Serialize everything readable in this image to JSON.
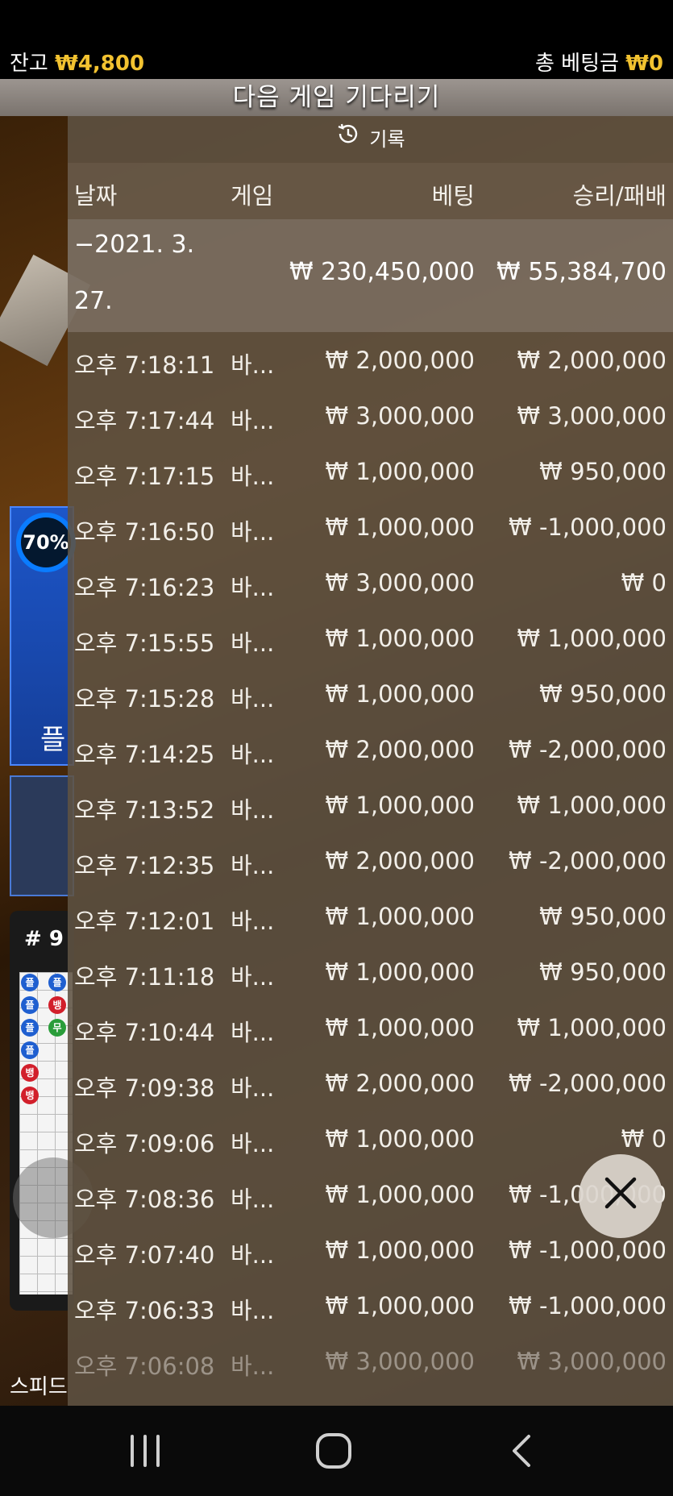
{
  "balance": {
    "label": "잔고",
    "amount": "₩4,800"
  },
  "total_bet": {
    "label": "총 베팅금",
    "amount": "₩0"
  },
  "status": "다음 게임 기다리기",
  "history": {
    "title": "기록",
    "columns": {
      "date": "날짜",
      "game": "게임",
      "bet": "베팅",
      "result": "승리/패배"
    },
    "summary": {
      "date_line1": "−2021. 3.",
      "date_line2": "27.",
      "bet": "₩ 230,450,000",
      "result": "₩ 55,384,700"
    },
    "rows": [
      {
        "time": "오후 7:18:11",
        "game": "바...",
        "bet": "₩ 2,000,000",
        "result": "₩ 2,000,000"
      },
      {
        "time": "오후 7:17:44",
        "game": "바...",
        "bet": "₩ 3,000,000",
        "result": "₩ 3,000,000"
      },
      {
        "time": "오후 7:17:15",
        "game": "바...",
        "bet": "₩ 1,000,000",
        "result": "₩ 950,000"
      },
      {
        "time": "오후 7:16:50",
        "game": "바...",
        "bet": "₩ 1,000,000",
        "result": "₩ -1,000,000"
      },
      {
        "time": "오후 7:16:23",
        "game": "바...",
        "bet": "₩ 3,000,000",
        "result": "₩ 0"
      },
      {
        "time": "오후 7:15:55",
        "game": "바...",
        "bet": "₩ 1,000,000",
        "result": "₩ 1,000,000"
      },
      {
        "time": "오후 7:15:28",
        "game": "바...",
        "bet": "₩ 1,000,000",
        "result": "₩ 950,000"
      },
      {
        "time": "오후 7:14:25",
        "game": "바...",
        "bet": "₩ 2,000,000",
        "result": "₩ -2,000,000"
      },
      {
        "time": "오후 7:13:52",
        "game": "바...",
        "bet": "₩ 1,000,000",
        "result": "₩ 1,000,000"
      },
      {
        "time": "오후 7:12:35",
        "game": "바...",
        "bet": "₩ 2,000,000",
        "result": "₩ -2,000,000"
      },
      {
        "time": "오후 7:12:01",
        "game": "바...",
        "bet": "₩ 1,000,000",
        "result": "₩ 950,000"
      },
      {
        "time": "오후 7:11:18",
        "game": "바...",
        "bet": "₩ 1,000,000",
        "result": "₩ 950,000"
      },
      {
        "time": "오후 7:10:44",
        "game": "바...",
        "bet": "₩ 1,000,000",
        "result": "₩ 1,000,000"
      },
      {
        "time": "오후 7:09:38",
        "game": "바...",
        "bet": "₩ 2,000,000",
        "result": "₩ -2,000,000"
      },
      {
        "time": "오후 7:09:06",
        "game": "바...",
        "bet": "₩ 1,000,000",
        "result": "₩ 0"
      },
      {
        "time": "오후 7:08:36",
        "game": "바...",
        "bet": "₩ 1,000,000",
        "result": "₩ -1,000,000"
      },
      {
        "time": "오후 7:07:40",
        "game": "바...",
        "bet": "₩ 1,000,000",
        "result": "₩ -1,000,000"
      },
      {
        "time": "오후 7:06:33",
        "game": "바...",
        "bet": "₩ 1,000,000",
        "result": "₩ -1,000,000"
      },
      {
        "time": "오후 7:06:08",
        "game": "바...",
        "bet": "₩ 3,000,000",
        "result": "₩ 3,000,000"
      }
    ]
  },
  "background_game": {
    "timer_percent": "70%",
    "panel_char": "플",
    "road_title": "# 9",
    "bottom_label": "스피드",
    "road_marks": [
      "플",
      "플",
      "플",
      "뱅",
      "플",
      "무",
      "플",
      "뱅",
      "뱅"
    ]
  },
  "colors": {
    "accent_gold": "#f2c230",
    "panel_blue": "#1d56c9",
    "player_blue": "#1f5fd0",
    "banker_red": "#d21f2b",
    "tie_green": "#2a9d3a"
  },
  "icons": {
    "history": "clock-history-icon",
    "close": "close-icon"
  }
}
